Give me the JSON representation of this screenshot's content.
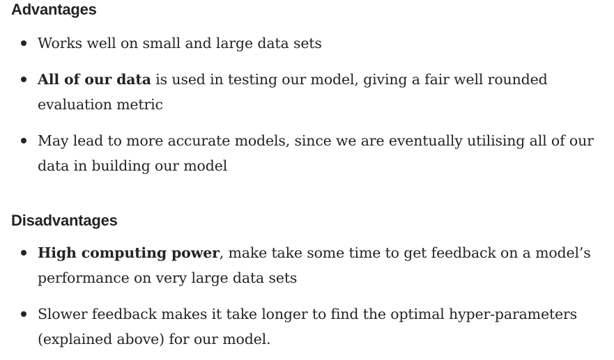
{
  "advantages": {
    "heading": "Advantages",
    "items": [
      {
        "bold": "",
        "text": "Works well on small and large data sets"
      },
      {
        "bold": "All of our data",
        "text": " is used in testing our model, giving a fair well rounded evaluation metric"
      },
      {
        "bold": "",
        "text": "May lead to more accurate models, since we are eventually utilising all of our data in building our model"
      }
    ]
  },
  "disadvantages": {
    "heading": "Disadvantages",
    "items": [
      {
        "bold": "High computing power",
        "text": ", make take some time to get feedback on a model’s performance on very large data sets"
      },
      {
        "bold": "",
        "text": "Slower feedback makes it take longer to find the optimal hyper-parameters (explained above) for our model."
      }
    ]
  }
}
